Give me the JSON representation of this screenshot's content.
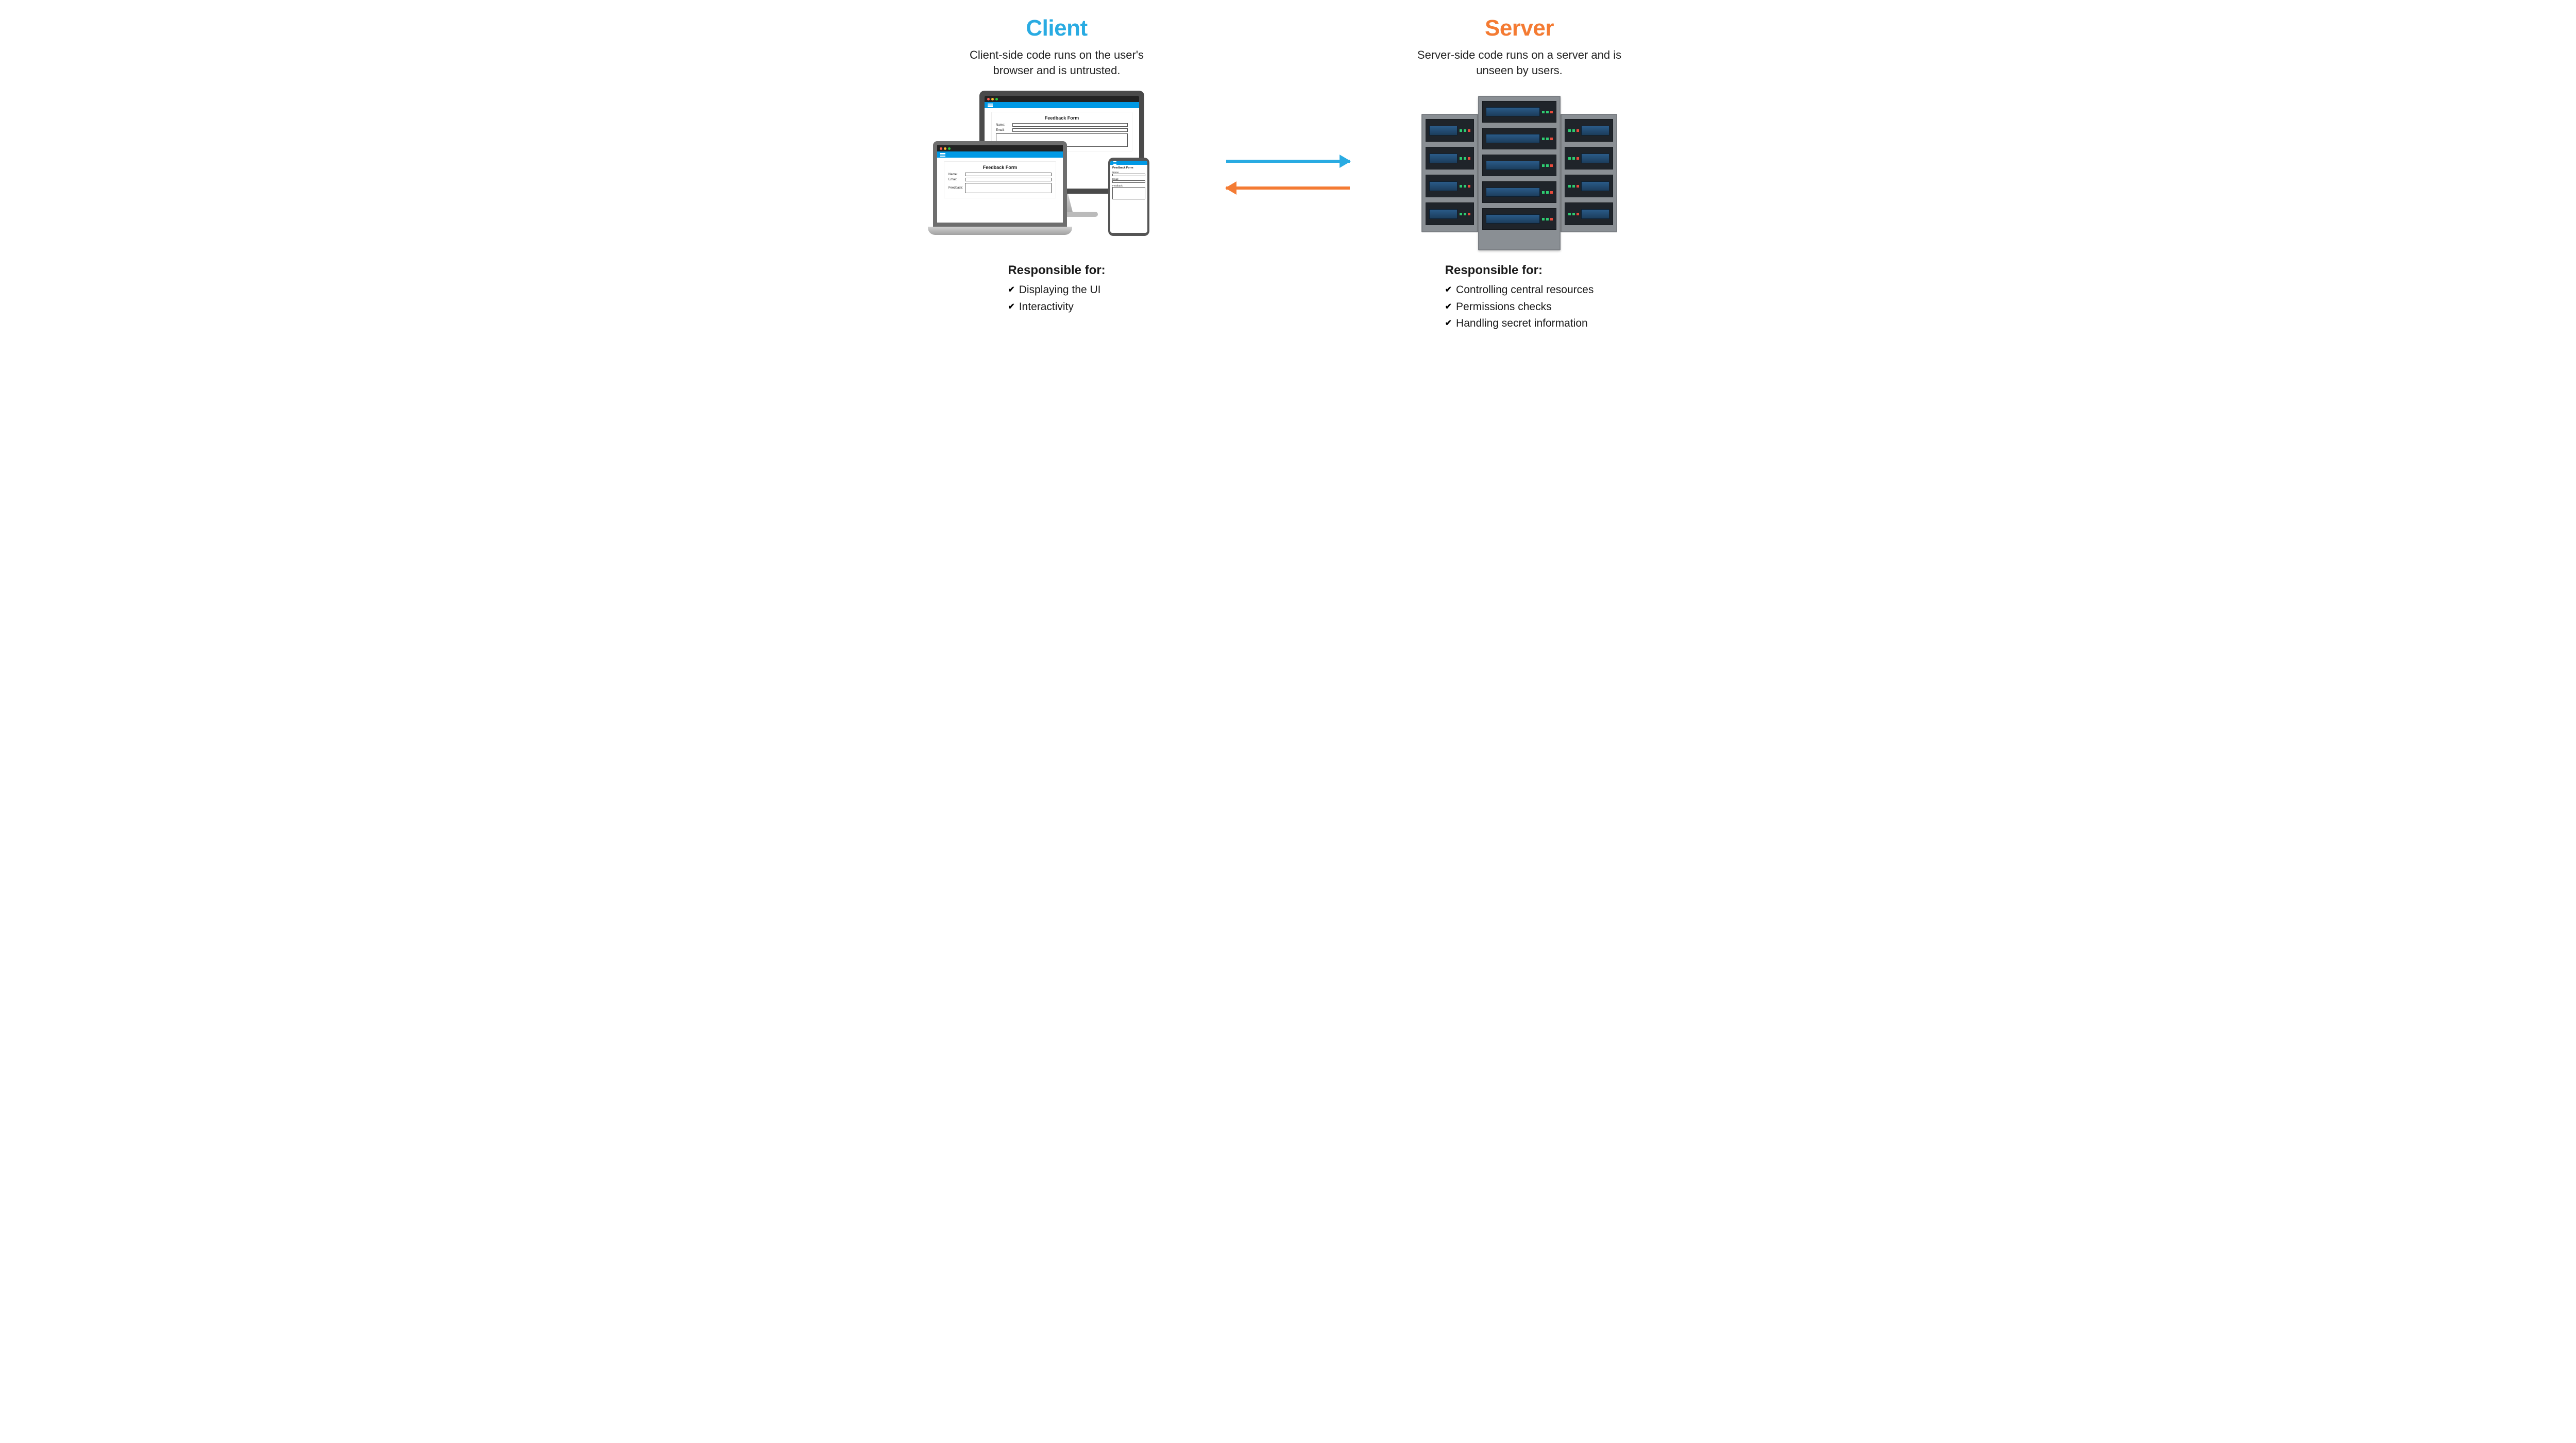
{
  "client": {
    "title": "Client",
    "tagline": "Client-side code runs on the user's browser and is untrusted.",
    "resp_heading": "Responsible for:",
    "responsibilities": [
      "Displaying the UI",
      "Interactivity"
    ]
  },
  "server": {
    "title": "Server",
    "tagline": "Server-side code runs on a server and is unseen by users.",
    "resp_heading": "Responsible for:",
    "responsibilities": [
      "Controlling central resources",
      "Permissions checks",
      "Handling secret information"
    ]
  },
  "form": {
    "title": "Feedback Form",
    "name_label": "Name:",
    "email_label": "Email:",
    "feedback_label": "Feedback:"
  },
  "colors": {
    "client": "#29abe2",
    "server": "#f47b33"
  }
}
